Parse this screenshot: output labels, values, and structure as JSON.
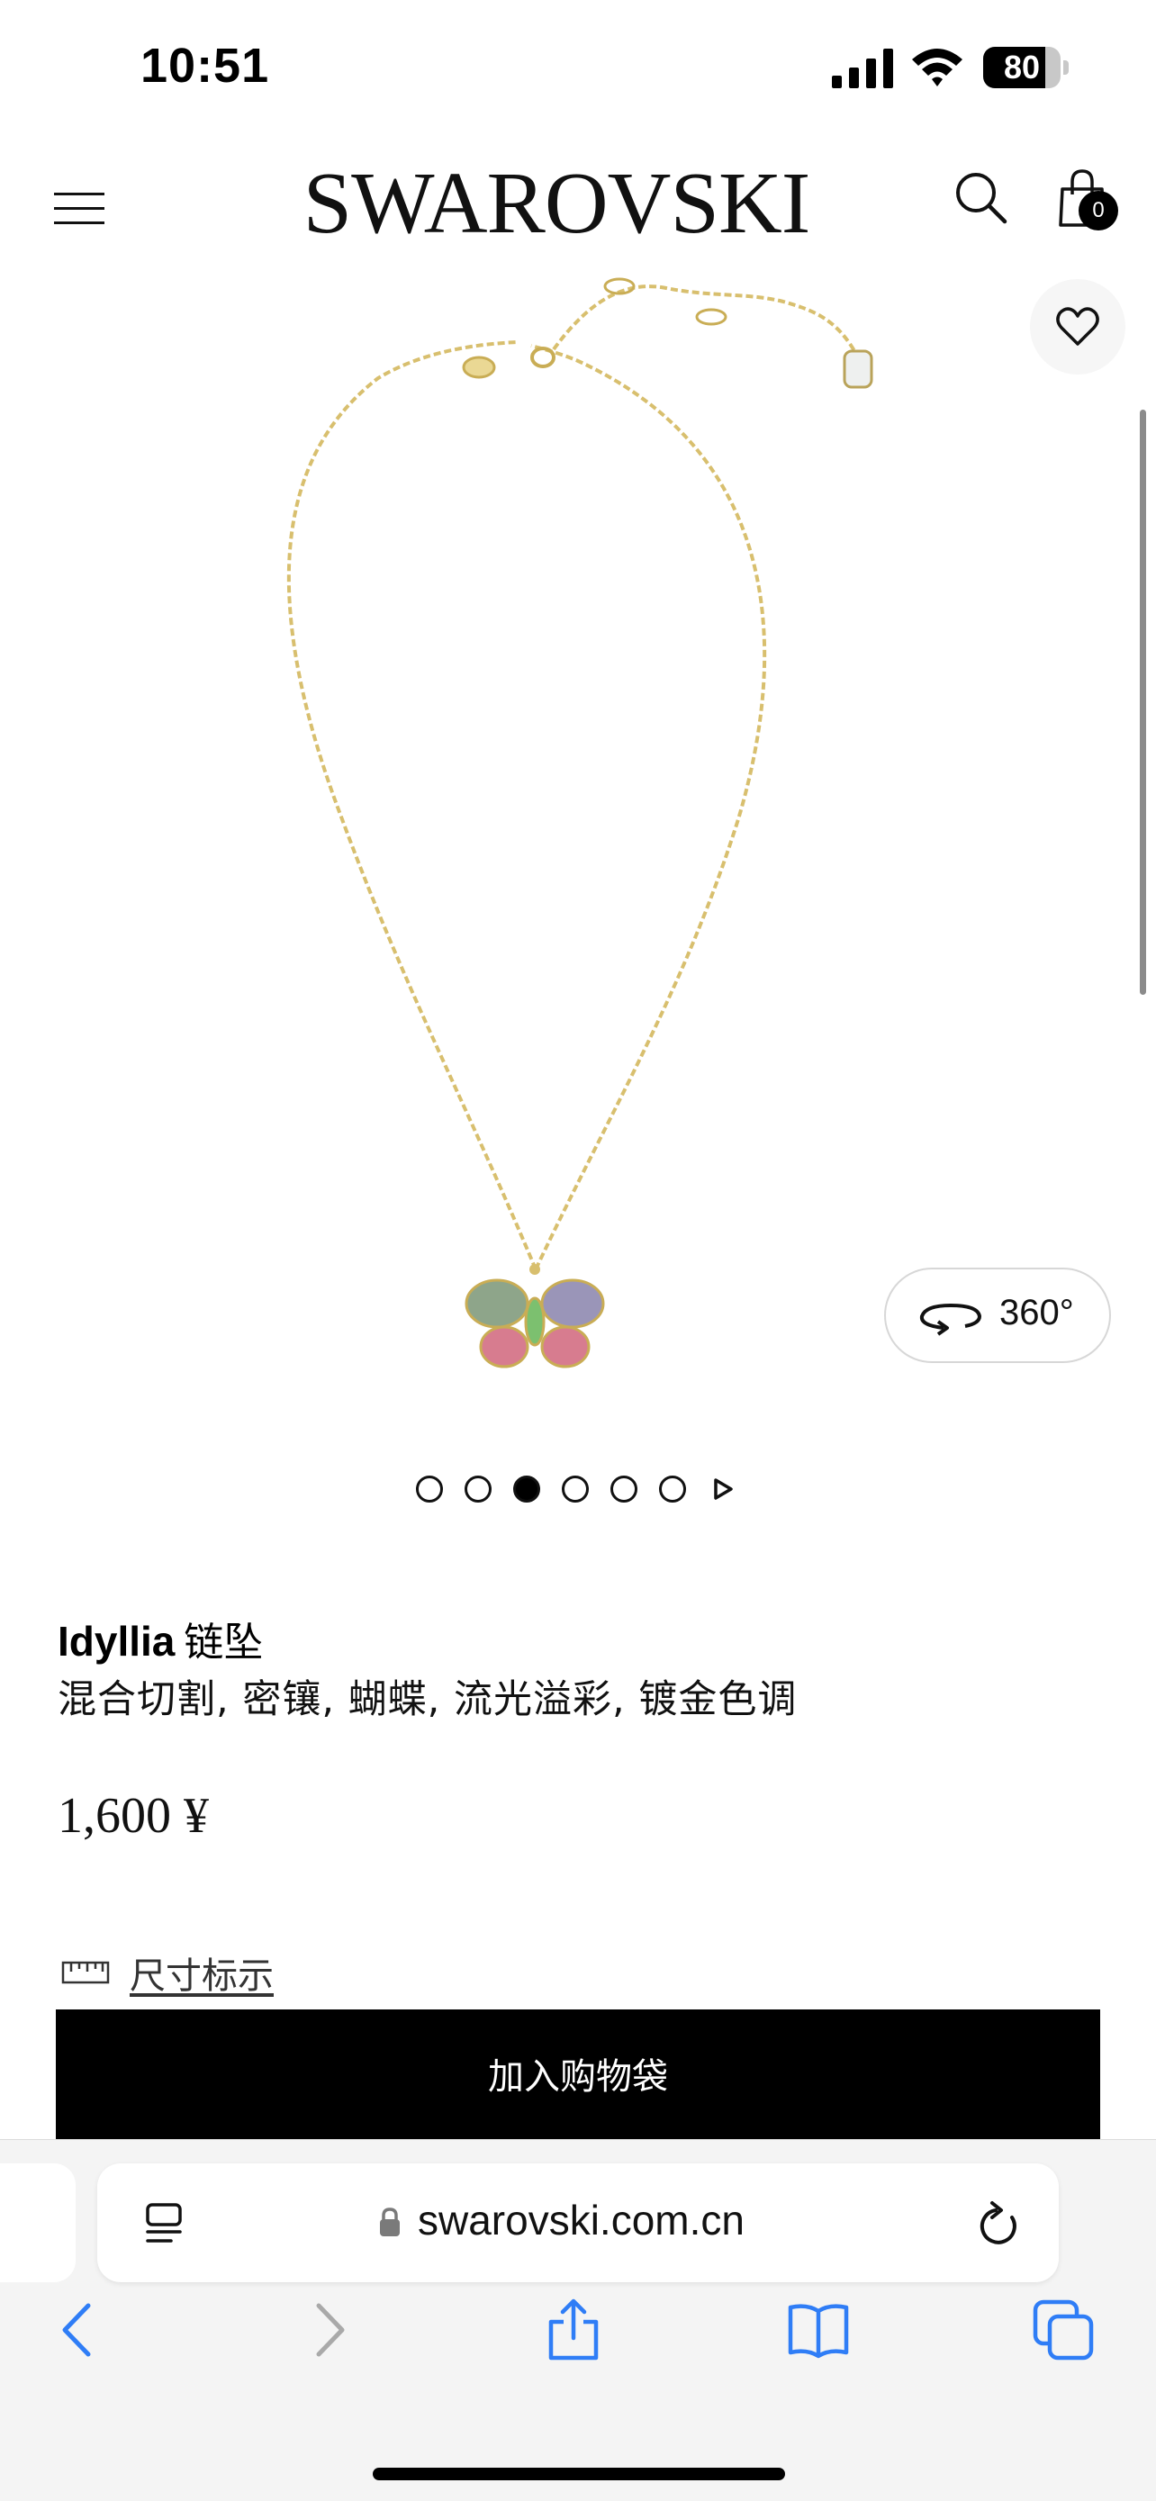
{
  "status_bar": {
    "time": "10:51",
    "battery_percent": 80,
    "battery_label": "80"
  },
  "header": {
    "brand": "SWAROVSKI",
    "bag_count": "0"
  },
  "gallery": {
    "view_360_label": "360°",
    "slide_count": 6,
    "active_slide": 3
  },
  "product": {
    "name_brand": "Idyllia",
    "name_type": "链坠",
    "description": "混合切割, 密镶, 蝴蝶, 流光溢彩, 镀金色调",
    "price": "1,600 ¥",
    "size_guide_label": "尺寸标示",
    "add_to_bag_label": "加入购物袋"
  },
  "browser": {
    "url": "swarovski.com.cn"
  },
  "colors": {
    "accent_link": "#2f7df6",
    "chain_gold": "#d8bf6e",
    "button_black": "#000000"
  },
  "icons": [
    "menu-icon",
    "search-icon",
    "shopping-bag-icon",
    "heart-icon",
    "rotate-360-icon",
    "play-next-icon",
    "ruler-icon",
    "reader-mode-icon",
    "lock-icon",
    "reload-icon",
    "back-arrow-icon",
    "forward-arrow-icon",
    "share-icon",
    "bookmarks-icon",
    "tabs-icon"
  ]
}
